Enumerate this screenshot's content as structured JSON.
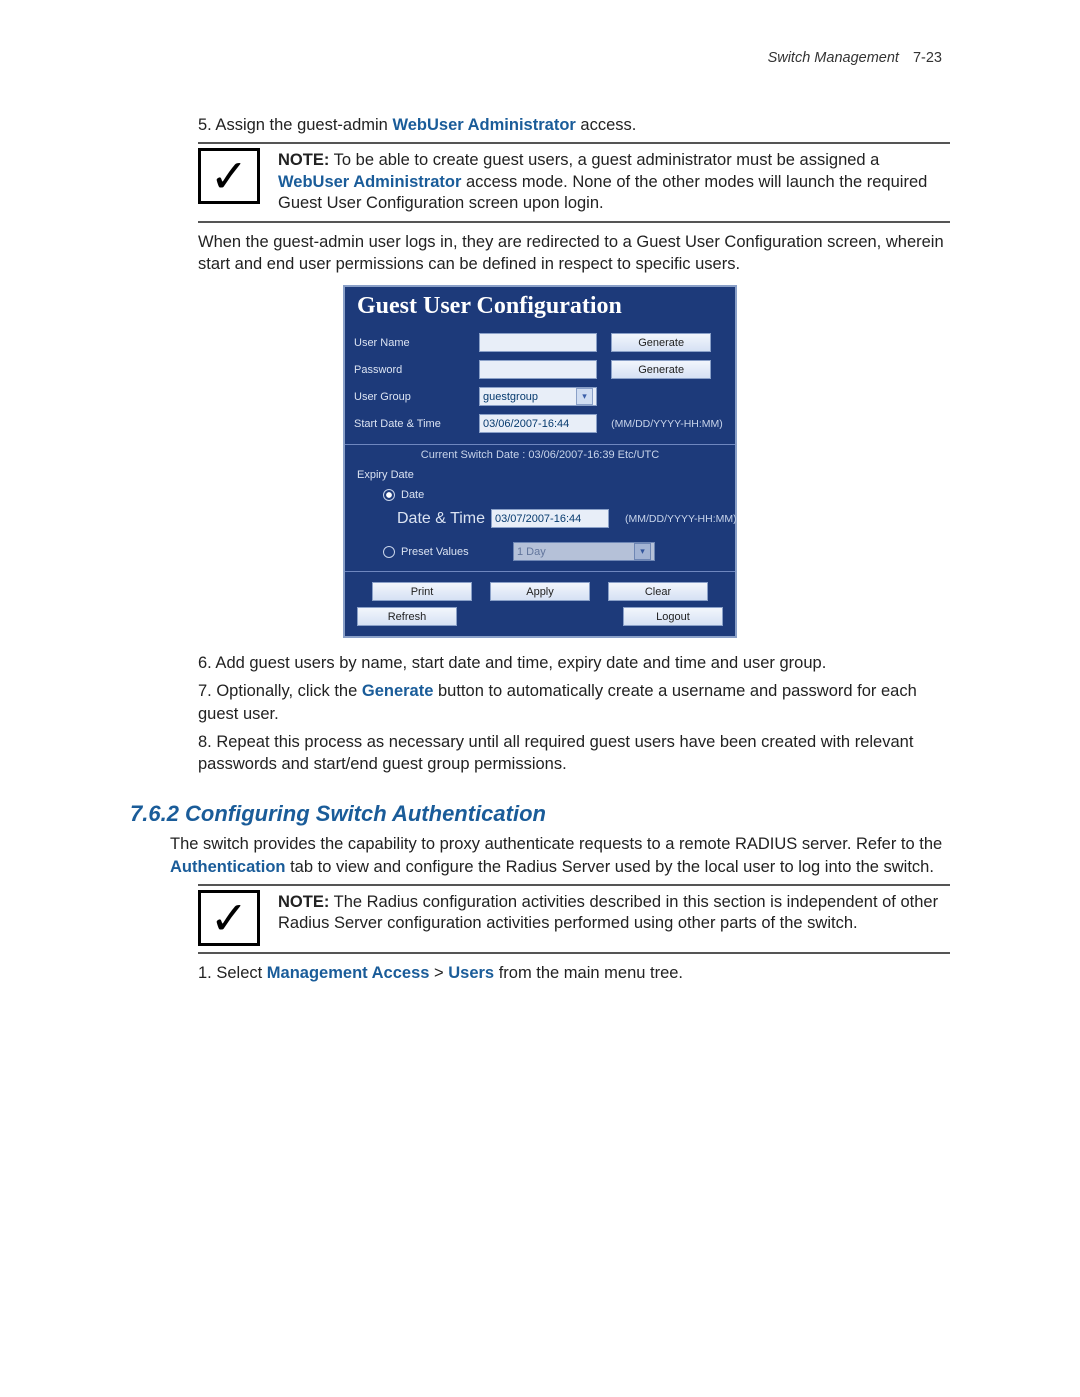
{
  "header": {
    "chapter": "Switch Management",
    "pagenum": "7-23"
  },
  "step5": {
    "prefix": "5. Assign the guest-admin ",
    "bold": "WebUser Administrator",
    "suffix": " access."
  },
  "note1": {
    "note_label": "NOTE:",
    "part1": " To be able to create guest users, a guest administrator must be assigned a ",
    "bold": "WebUser Administrator",
    "part2": " access mode. None of the other modes will launch the required Guest User Configuration screen upon login."
  },
  "para_after_note1": "When the guest-admin user logs in, they are redirected to a Guest User Configuration screen, wherein start and end user permissions can be defined in respect to specific users.",
  "screenshot": {
    "title": "Guest User Configuration",
    "rows": {
      "username_label": "User Name",
      "password_label": "Password",
      "usergroup_label": "User Group",
      "usergroup_value": "guestgroup",
      "startdate_label": "Start Date & Time",
      "startdate_value": "03/06/2007-16:44",
      "date_hint": "(MM/DD/YYYY-HH:MM)",
      "generate_btn": "Generate"
    },
    "current_switch_date": "Current Switch Date : 03/06/2007-16:39 Etc/UTC",
    "expiry_label": "Expiry Date",
    "radio_date": "Date",
    "expiry_datetime_label": "Date & Time",
    "expiry_datetime_value": "03/07/2007-16:44",
    "radio_preset": "Preset Values",
    "preset_value": "1 Day",
    "buttons": {
      "print": "Print",
      "apply": "Apply",
      "clear": "Clear",
      "refresh": "Refresh",
      "logout": "Logout"
    }
  },
  "step6": "6. Add guest users by name, start date and time, expiry date and time and user group.",
  "step7": {
    "prefix": "7. Optionally, click the ",
    "bold": "Generate",
    "suffix": " button to automatically create a username and password for each guest user."
  },
  "step8": "8. Repeat this process as necessary until all required guest users have been created with relevant passwords and start/end guest group permissions.",
  "section762": {
    "title": "7.6.2 Configuring Switch Authentication",
    "para_prefix": "The switch provides the capability to proxy authenticate requests to a remote RADIUS server. Refer to the ",
    "para_bold": "Authentication",
    "para_suffix": " tab to view and configure the Radius Server used by the local user to log into the switch."
  },
  "note2": {
    "note_label": "NOTE:",
    "text": " The Radius configuration activities described in this section is independent of other Radius Server configuration activities performed using other parts of the switch."
  },
  "step_sel": {
    "prefix": "1. Select ",
    "bold1": "Management Access",
    "gt": " > ",
    "bold2": "Users",
    "suffix": " from the main menu tree."
  }
}
